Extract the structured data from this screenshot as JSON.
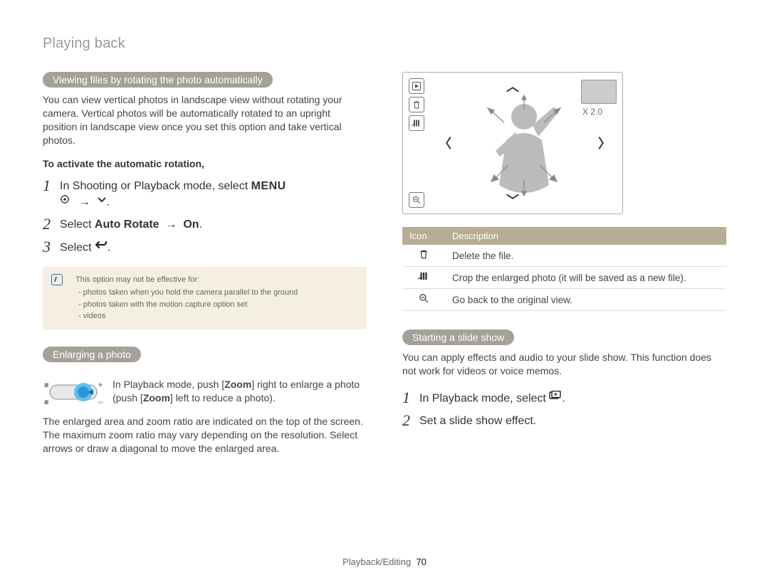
{
  "pageTitle": "Playing back",
  "left": {
    "pill1": "Viewing files by rotating the photo automatically",
    "para1": "You can view vertical photos in landscape view without rotating your camera. Vertical photos will be automatically rotated to an upright position in landscape view once you set this option and take vertical photos.",
    "activateLine": "To activate the automatic rotation,",
    "steps1": {
      "s1": "In Shooting or Playback mode, select ",
      "s1_menu": "MENU",
      "s1_arrow": " → ",
      "s1_end": ".",
      "s2_pre": "Select ",
      "s2_bold": "Auto Rotate",
      "s2_arrow": " → ",
      "s2_on": "On",
      "s2_end": ".",
      "s3": "Select ",
      "s3_end": "."
    },
    "note": {
      "title": "This option may not be effective for:",
      "items": [
        "photos taken when you hold the camera parallel to the ground",
        "photos taken with the motion capture option set",
        "videos"
      ]
    },
    "pill2": "Enlarging a photo",
    "toggle": {
      "line1_pre": "In Playback mode, push [",
      "line1_zoom": "Zoom",
      "line1_mid": "] right to enlarge a photo (push [",
      "line1_zoom2": "Zoom",
      "line1_end": "] left to reduce a photo)."
    },
    "para2": "The enlarged area and zoom ratio are indicated on the top of the screen. The maximum zoom ratio may vary depending on the resolution. Select arrows or draw a diagonal to move the enlarged area."
  },
  "right": {
    "zoomLabel": "X 2.0",
    "table": {
      "h1": "Icon",
      "h2": "Description",
      "rows": [
        {
          "icon": "trash",
          "desc": "Delete the file."
        },
        {
          "icon": "crop",
          "desc": "Crop the enlarged photo (it will be saved as a new file)."
        },
        {
          "icon": "zoom",
          "desc": "Go back to the original view."
        }
      ]
    },
    "pill": "Starting a slide show",
    "para": "You can apply effects and audio to your slide show. This function does not work for videos or voice memos.",
    "steps": {
      "s1": "In Playback mode, select ",
      "s1_end": ".",
      "s2": "Set a slide show effect."
    }
  },
  "footer": {
    "section": "Playback/Editing",
    "page": "70"
  }
}
